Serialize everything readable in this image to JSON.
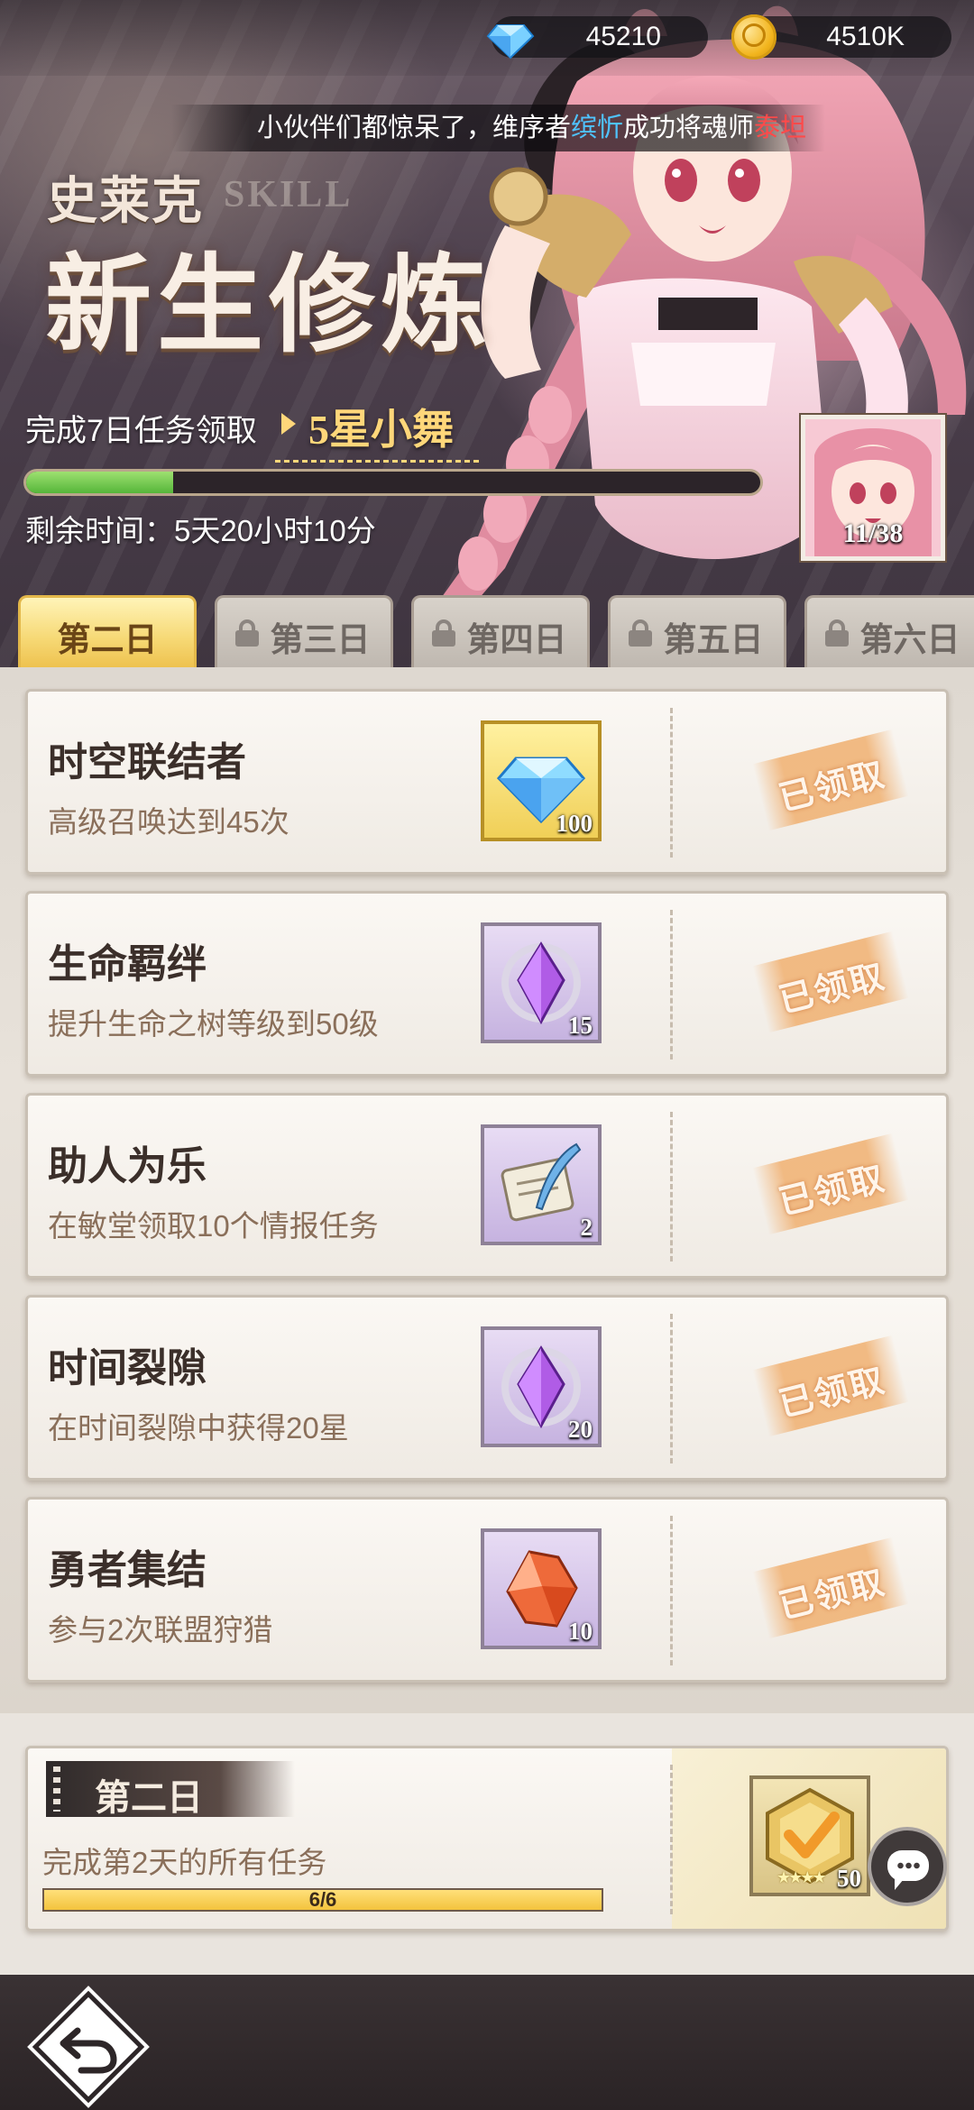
{
  "currency": {
    "diamonds": "45210",
    "gold": "4510K"
  },
  "ticker": {
    "prefix": "小伙伴们都惊呆了，维序者",
    "player": "缤忻",
    "middle": "成功将魂师",
    "target": "泰坦"
  },
  "banner": {
    "subtitle": "史莱克",
    "subtitle_en": "SKILL",
    "title": "新生修炼",
    "task_text": "完成7日任务领取",
    "reward_hero": "5星小舞",
    "progress_fraction": 0.2,
    "remaining_time": "剩余时间：5天20小时10分",
    "portrait_count": "11/38"
  },
  "tabs": [
    {
      "label": "第二日",
      "active": true,
      "locked": false
    },
    {
      "label": "第三日",
      "active": false,
      "locked": true
    },
    {
      "label": "第四日",
      "active": false,
      "locked": true
    },
    {
      "label": "第五日",
      "active": false,
      "locked": true
    },
    {
      "label": "第六日",
      "active": false,
      "locked": true
    }
  ],
  "tasks": [
    {
      "name": "时空联结者",
      "desc": "高级召唤达到45次",
      "reward_icon": "diamond-icon",
      "reward_qty": "100",
      "status": "已领取"
    },
    {
      "name": "生命羁绊",
      "desc": "提升生命之树等级到50级",
      "reward_icon": "purple-crystal-icon",
      "reward_qty": "15",
      "status": "已领取"
    },
    {
      "name": "助人为乐",
      "desc": "在敏堂领取10个情报任务",
      "reward_icon": "scroll-feather-icon",
      "reward_qty": "2",
      "status": "已领取"
    },
    {
      "name": "时间裂隙",
      "desc": "在时间裂隙中获得20星",
      "reward_icon": "purple-crystal-icon",
      "reward_qty": "20",
      "status": "已领取"
    },
    {
      "name": "勇者集结",
      "desc": "参与2次联盟狩猎",
      "reward_icon": "red-crystal-icon",
      "reward_qty": "10",
      "status": "已领取"
    }
  ],
  "summary": {
    "tag": "第二日",
    "desc": "完成第2天的所有任务",
    "progress_text": "6/6",
    "progress_fraction": 1.0,
    "reward_qty": "50",
    "reward_stars": "★★★★",
    "reward_icon": "gold-badge-icon"
  },
  "colors": {
    "tab_active": "#f6d874",
    "progress_green": "#55b63a",
    "progress_yellow": "#f3c33d",
    "ticker_blue": "#4fc3ff",
    "ticker_red": "#ff4a4a"
  }
}
